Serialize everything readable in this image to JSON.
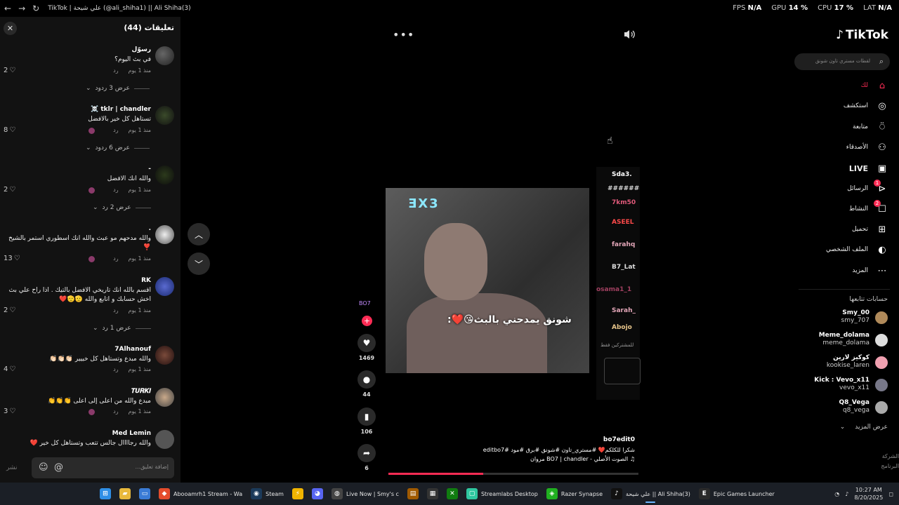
{
  "browser": {
    "title": "TikTok | علي شيحة (@ali_shiha1) || Ali Shiha(3)",
    "stats": [
      {
        "label": "FPS",
        "value": "N/A"
      },
      {
        "label": "GPU",
        "value": "14 %"
      },
      {
        "label": "CPU",
        "value": "17 %"
      },
      {
        "label": "LAT",
        "value": "N/A"
      }
    ]
  },
  "comments": {
    "title": "تعليقات (44)",
    "input_placeholder": "إضافة تعليق...",
    "post_label": "نشر",
    "items": [
      {
        "name": "رسوّل",
        "text": "في بث اليوم؟",
        "time": "منذ 1 يوم",
        "reply": "رد",
        "likes": "2",
        "replies": "عرض 3 ردود"
      },
      {
        "name": "tklr | chandler ☠️",
        "text": "تستاهل كل خير بالافضل",
        "time": "منذ 1 يوم",
        "reply": "رد",
        "likes": "8",
        "replies": "عرض 6 ردود"
      },
      {
        "name": "-",
        "text": "والله انك الافضل",
        "time": "منذ 1 يوم",
        "reply": "رد",
        "likes": "2",
        "replies": "عرض 2 رد"
      },
      {
        "name": ".",
        "text": "والله مدحهم مو عبث والله انك اسطوري استمر بالشيخ ❣️",
        "time": "منذ 1 يوم",
        "reply": "رد",
        "likes": "13",
        "replies": ""
      },
      {
        "name": "RK",
        "text": "اقسم بالله انك تاريخي الافضل بالتيك . اذا راح علي بث اخش حسابك و اتابع والله 🫡🫡❤️",
        "time": "منذ 1 يوم",
        "reply": "رد",
        "likes": "2",
        "replies": "عرض 1 رد"
      },
      {
        "name": "7Alhanouf",
        "text": "والله مبدع وتستاهل كل خييير 👏🏻👏🏻👏🏻",
        "time": "منذ 1 يوم",
        "reply": "رد",
        "likes": "4",
        "replies": ""
      },
      {
        "name": "𝑻𝑼𝑹𝑲𝑰",
        "text": "مبدع والله من اعلى إلى اعلى 👏👏👏",
        "time": "منذ 1 يوم",
        "reply": "رد",
        "likes": "3",
        "replies": ""
      },
      {
        "name": "Med Lemin",
        "text": "والله رجاااال جالس تتعب وتستاهل كل خير ❤️",
        "time": "",
        "reply": "",
        "likes": "",
        "replies": ""
      }
    ]
  },
  "video": {
    "sign_text": "ƎX3",
    "overlay_text": "شونق يمدحني بالبث😘❤️:",
    "chat_users": [
      "Sda3.",
      "########",
      "7km50",
      "ASEEL",
      "farahq",
      "B7_Lat",
      "osama1_1",
      "Sarah_",
      "Abojo"
    ],
    "chat_note": "للمشتركين فقط",
    "creator_tag": "BO7",
    "likes": "1469",
    "comments": "44",
    "saves": "106",
    "shares": "6",
    "author": "bo7edit0",
    "caption": "شكرا للكلكم❤️ #مستري_تاون #شونق #برق #مود #editbo7",
    "sound": "♫ الصوت الأصلي - BO7 | chandler مروان",
    "progress": 0.38
  },
  "sidebar": {
    "logo": "TikTok",
    "search_placeholder": "لقطات مستري تاون شونق",
    "nav": [
      {
        "label": "لك",
        "icon": "home-icon",
        "glyph": "⌂",
        "active": true,
        "badge": ""
      },
      {
        "label": "استكشف",
        "icon": "compass-icon",
        "glyph": "◎",
        "active": false,
        "badge": ""
      },
      {
        "label": "متابعة",
        "icon": "following-icon",
        "glyph": "⍥",
        "active": false,
        "badge": ""
      },
      {
        "label": "الأصدقاء",
        "icon": "friends-icon",
        "glyph": "⚇",
        "active": false,
        "badge": ""
      },
      {
        "label": "LIVE",
        "icon": "live-icon",
        "glyph": "▣",
        "active": false,
        "badge": ""
      },
      {
        "label": "الرسائل",
        "icon": "messages-icon",
        "glyph": "⊳",
        "active": false,
        "badge": "1"
      },
      {
        "label": "النشاط",
        "icon": "activity-icon",
        "glyph": "☐",
        "active": false,
        "badge": "2"
      },
      {
        "label": "تحميل",
        "icon": "upload-icon",
        "glyph": "⊞",
        "active": false,
        "badge": ""
      },
      {
        "label": "الملف الشخصي",
        "icon": "profile-icon",
        "glyph": "◐",
        "active": false,
        "badge": ""
      },
      {
        "label": "المزيد",
        "icon": "more-icon",
        "glyph": "⋯",
        "active": false,
        "badge": ""
      }
    ],
    "following_title": "حسابات تتابعها",
    "following": [
      {
        "name": "Smy_00",
        "handle": "smy_707"
      },
      {
        "name": "Meme_dolama",
        "handle": "meme_dolama"
      },
      {
        "name": "كوكيز لارين",
        "handle": "kookise_laren"
      },
      {
        "name": "Kick : Vevo_x11",
        "handle": "vevo_x11"
      },
      {
        "name": "Q8_Vega",
        "handle": "q8_vega"
      }
    ],
    "see_more": "عرض المزيد",
    "bottom_links": [
      "الشركة",
      "البرنامج"
    ]
  },
  "taskbar": {
    "items": [
      {
        "label": "",
        "icon": "windows-start-icon",
        "color": "#2f8fe6"
      },
      {
        "label": "",
        "icon": "file-explorer-icon",
        "color": "#e8b83c"
      },
      {
        "label": "",
        "icon": "folder-icon",
        "color": "#3a7bd5"
      },
      {
        "label": "Abooamrh1 Stream - Wa",
        "icon": "brave-icon",
        "color": "#e44c2c"
      },
      {
        "label": "Steam",
        "icon": "steam-icon",
        "color": "#1b3a5a"
      },
      {
        "label": "",
        "icon": "app-icon",
        "color": "#f0b400"
      },
      {
        "label": "",
        "icon": "discord-icon",
        "color": "#5865f2"
      },
      {
        "label": "Live Now | Smy's c",
        "icon": "chrome-icon",
        "color": "#444"
      },
      {
        "label": "",
        "icon": "misc-icon",
        "color": "#a05a00"
      },
      {
        "label": "",
        "icon": "store-icon",
        "color": "#333"
      },
      {
        "label": "",
        "icon": "xbox-icon",
        "color": "#107c10"
      },
      {
        "label": "Streamlabs Desktop",
        "icon": "streamlabs-icon",
        "color": "#2fc7a0"
      },
      {
        "label": "Razer Synapse",
        "icon": "razer-icon",
        "color": "#20b020"
      },
      {
        "label": "علي شيحة || Ali Shiha(3)",
        "icon": "tiktok-icon",
        "color": "#111"
      },
      {
        "label": "Epic Games Launcher",
        "icon": "epic-icon",
        "color": "#2a2a2a"
      }
    ],
    "time": "10:27 AM",
    "date": "8/20/2025"
  }
}
